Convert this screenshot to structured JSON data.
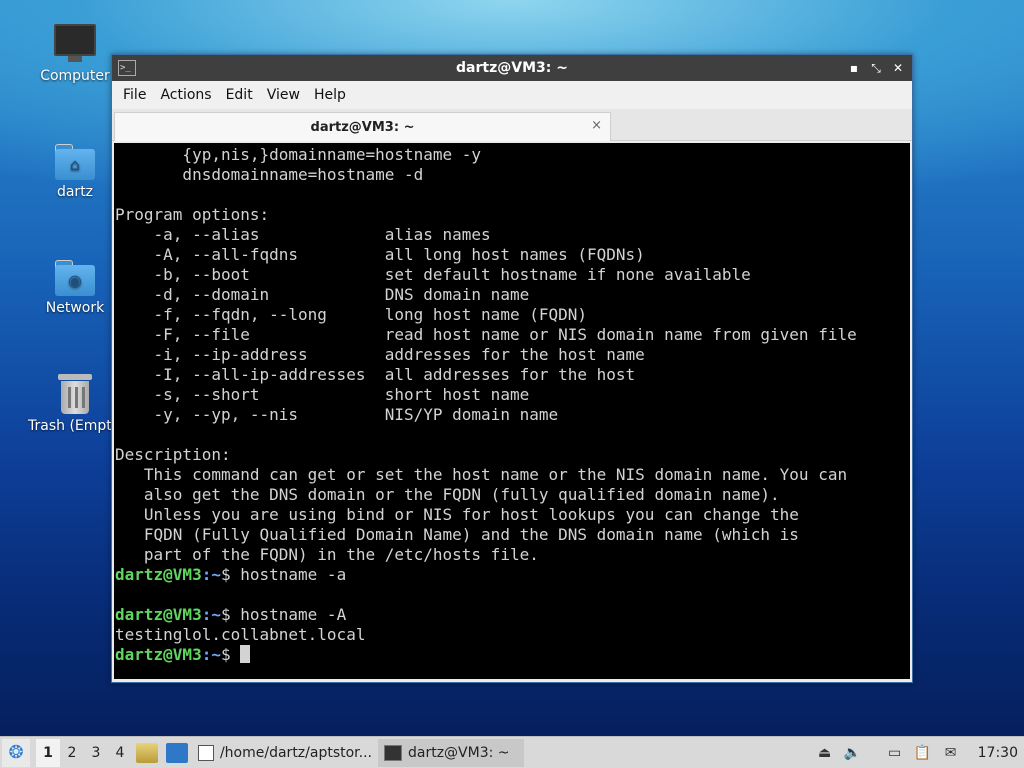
{
  "desktop": {
    "icons": [
      {
        "label": "Computer"
      },
      {
        "label": "dartz"
      },
      {
        "label": "Network"
      },
      {
        "label": "Trash (Empty)"
      }
    ]
  },
  "window": {
    "title": "dartz@VM3: ~",
    "menu": [
      "File",
      "Actions",
      "Edit",
      "View",
      "Help"
    ],
    "tab_label": "dartz@VM3: ~",
    "tab_close": "×"
  },
  "terminal": {
    "text_lines": [
      "       {yp,nis,}domainname=hostname -y",
      "       dnsdomainname=hostname -d",
      "",
      "Program options:",
      "    -a, --alias             alias names",
      "    -A, --all-fqdns         all long host names (FQDNs)",
      "    -b, --boot              set default hostname if none available",
      "    -d, --domain            DNS domain name",
      "    -f, --fqdn, --long      long host name (FQDN)",
      "    -F, --file              read host name or NIS domain name from given file",
      "    -i, --ip-address        addresses for the host name",
      "    -I, --all-ip-addresses  all addresses for the host",
      "    -s, --short             short host name",
      "    -y, --yp, --nis         NIS/YP domain name",
      "",
      "Description:",
      "   This command can get or set the host name or the NIS domain name. You can",
      "   also get the DNS domain or the FQDN (fully qualified domain name).",
      "   Unless you are using bind or NIS for host lookups you can change the",
      "   FQDN (Fully Qualified Domain Name) and the DNS domain name (which is",
      "   part of the FQDN) in the /etc/hosts file."
    ],
    "prompt_user": "dartz@VM3",
    "prompt_path": ":~",
    "prompt_sym": "$ ",
    "cmd1": "hostname -a",
    "cmd2": "hostname -A",
    "output2": "testinglol.collabnet.local",
    "cmd3": ""
  },
  "taskbar": {
    "workspaces": [
      "1",
      "2",
      "3",
      "4"
    ],
    "tasks": [
      "/home/dartz/aptstor...",
      "dartz@VM3: ~"
    ],
    "clock": "17:30"
  },
  "colors": {
    "prompt_user": "#5fd75f",
    "prompt_path": "#6fa8ff",
    "terminal_bg": "#000000",
    "titlebar_bg": "#3f3f3f"
  }
}
